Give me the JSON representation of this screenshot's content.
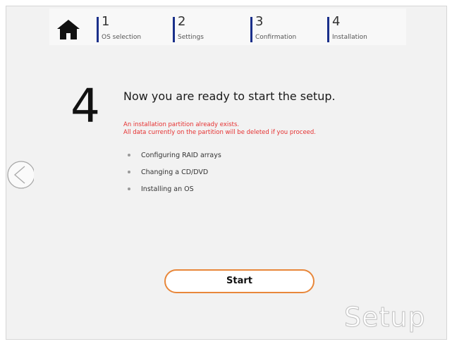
{
  "header": {
    "home_icon": "home-icon",
    "steps": [
      {
        "num": "1",
        "label": "OS selection"
      },
      {
        "num": "2",
        "label": "Settings"
      },
      {
        "num": "3",
        "label": "Confirmation"
      },
      {
        "num": "4",
        "label": "Installation"
      }
    ],
    "accent_color": "#1a2f8a"
  },
  "nav": {
    "back_icon": "back-arrow-circle-icon"
  },
  "main": {
    "step_number": "4",
    "title": "Now you are ready to start the setup.",
    "warning_line1": "An installation partition already exists.",
    "warning_line2": "All data currently on the partition will be deleted if you proceed.",
    "warning_color": "#e53030",
    "tasks": [
      "Configuring RAID arrays",
      "Changing a CD/DVD",
      "Installing an OS"
    ]
  },
  "actions": {
    "start_label": "Start",
    "start_border_color": "#e8873a"
  },
  "watermark": "Setup"
}
